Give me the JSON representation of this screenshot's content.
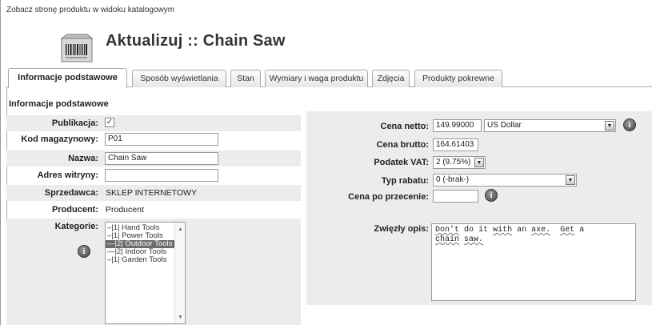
{
  "view_link": "Zobacz stronę produktu w widoku katalogowym",
  "title": "Aktualizuj :: Chain Saw",
  "tabs": [
    {
      "label": "Informacje podstawowe",
      "active": true
    },
    {
      "label": "Sposób wyświetlania",
      "active": false
    },
    {
      "label": "Stan",
      "active": false
    },
    {
      "label": "Wymiary i waga produktu",
      "active": false
    },
    {
      "label": "Zdjęcia",
      "active": false
    },
    {
      "label": "Produkty pokrewne",
      "active": false
    }
  ],
  "section_title": "Informacje podstawowe",
  "left": {
    "publikacja": {
      "label": "Publikacja:",
      "checked": true
    },
    "kod": {
      "label": "Kod magazynowy:",
      "value": "P01"
    },
    "nazwa": {
      "label": "Nazwa:",
      "value": "Chain Saw"
    },
    "adres": {
      "label": "Adres witryny:",
      "value": ""
    },
    "sprzedawca": {
      "label": "Sprzedawca:",
      "value": "SKLEP INTERNETOWY"
    },
    "producent": {
      "label": "Producent:",
      "value": "Producent"
    },
    "kategorie": {
      "label": "Kategorie:",
      "items": [
        {
          "text": "–|1| Hand Tools",
          "selected": false
        },
        {
          "text": "–|1| Power Tools",
          "selected": false
        },
        {
          "text": "—|2| Outdoor Tools",
          "selected": true
        },
        {
          "text": "—|2| Indoor Tools",
          "selected": false
        },
        {
          "text": "–|1| Garden Tools",
          "selected": false
        }
      ]
    }
  },
  "right": {
    "cena_netto": {
      "label": "Cena netto:",
      "value": "149.99000",
      "currency": "US Dollar"
    },
    "cena_brutto": {
      "label": "Cena brutto:",
      "value": "164.61403"
    },
    "podatek": {
      "label": "Podatek VAT:",
      "value": "2 (9.75%)"
    },
    "rabat": {
      "label": "Typ rabatu:",
      "value": "0 (-brak-)"
    },
    "przecena": {
      "label": "Cena po przecenie:",
      "value": ""
    },
    "opis": {
      "label": "Zwięzły opis:",
      "line1_words": [
        "Don't",
        "do",
        "it",
        "with",
        "an",
        "axe.",
        "Get",
        "a"
      ],
      "line2_words": [
        "chain",
        "saw."
      ]
    }
  },
  "icons": {
    "info": "i",
    "check": "✓",
    "dropdown": "▼",
    "scroll_up": "▲",
    "scroll_down": "▼"
  }
}
